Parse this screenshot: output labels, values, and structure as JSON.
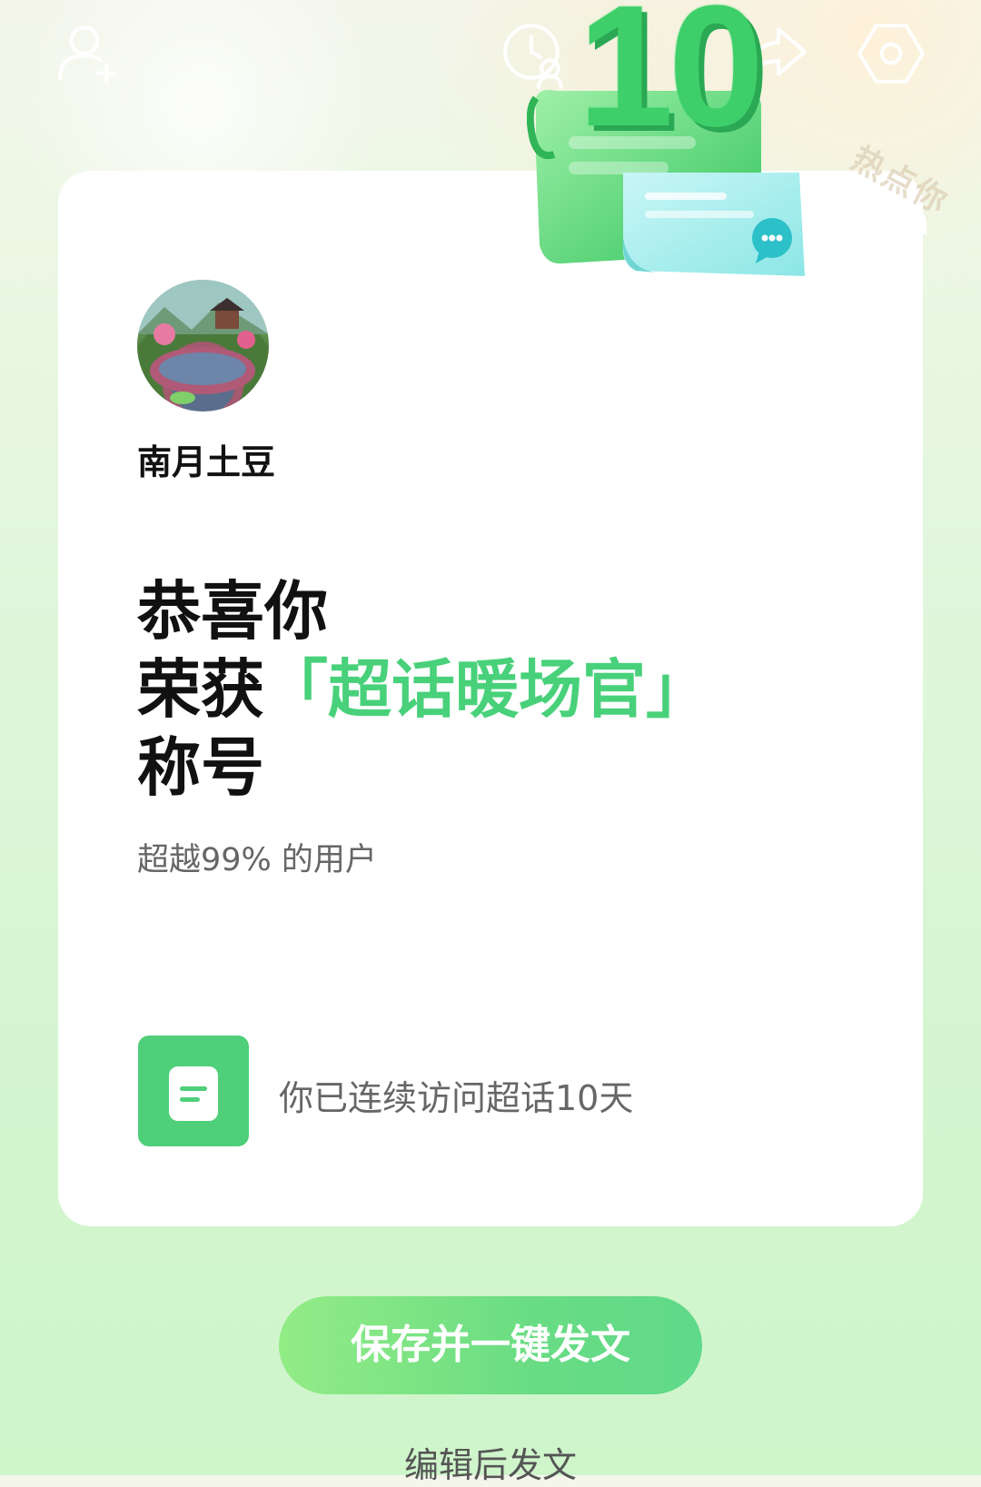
{
  "toolbar": {
    "add_friend_icon": "add-friend-icon",
    "visitors_icon": "visitors-icon",
    "share_icon": "share-icon",
    "settings_icon": "settings-icon"
  },
  "badge": {
    "number": "10",
    "stamp_text": "热点你"
  },
  "profile": {
    "username": "南月土豆"
  },
  "headline": {
    "line1": "恭喜你",
    "line2_prefix": "荣获",
    "title": "「超话暖场官」",
    "line3": "称号"
  },
  "stats": {
    "percent_text": "超越99% 的用户",
    "visit_text": "你已连续访问超话10天"
  },
  "actions": {
    "primary_label": "保存并一键发文",
    "secondary_label": "编辑后发文"
  },
  "colors": {
    "accent": "#48d17a",
    "button_start": "#93ec86",
    "button_end": "#5fd98a"
  }
}
